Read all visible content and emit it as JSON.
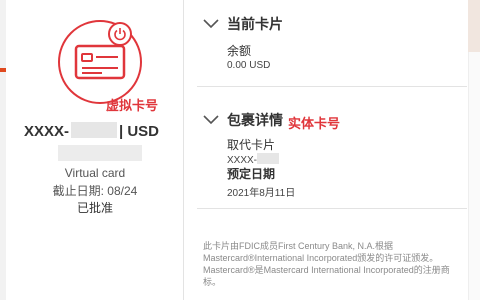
{
  "left": {
    "annotation_virtual": "虚拟卡号",
    "card_prefix": "XXXX-",
    "card_suffix": "| USD",
    "card_type": "Virtual card",
    "expiry": "截止日期: 08/24",
    "status": "已批准",
    "icons": [
      "credit-card-icon",
      "power-icon"
    ]
  },
  "current_card": {
    "title": "当前卡片",
    "balance_label": "余额",
    "balance_value": "0.00 USD"
  },
  "package": {
    "title": "包裹详情",
    "annotation_physical": "实体卡号",
    "replace_label": "取代卡片",
    "masked_number": "XXXX-",
    "est_label": "预定日期",
    "est_date": "2021年8月11日"
  },
  "disclaimer": {
    "text_before": "此卡片由FDIC成员First Century Bank, N.A.根据Mastercard®International Incorporated颁发的许可证颁发。Mastercard®是Mastercard International Incorporated的注册商标。"
  },
  "colors": {
    "accent_red": "#e0363b",
    "orange": "#e04a1f"
  }
}
